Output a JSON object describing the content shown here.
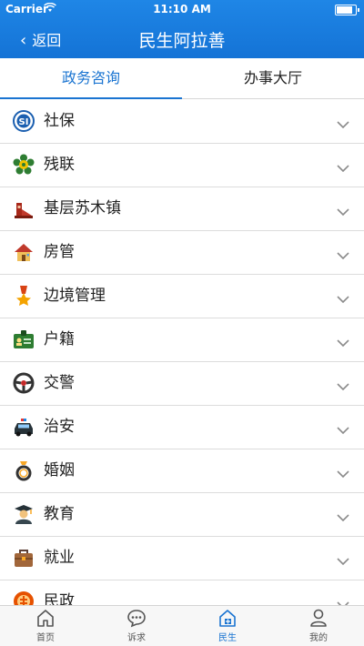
{
  "status": {
    "carrier": "Carrier",
    "time": "11:10 AM"
  },
  "nav": {
    "back_label": "返回",
    "title": "民生阿拉善"
  },
  "tabs": [
    {
      "label": "政务咨询",
      "active": true
    },
    {
      "label": "办事大厅",
      "active": false
    }
  ],
  "items": [
    {
      "label": "社保",
      "icon": "social-security-icon"
    },
    {
      "label": "残联",
      "icon": "disabled-federation-icon"
    },
    {
      "label": "基层苏木镇",
      "icon": "township-icon"
    },
    {
      "label": "房管",
      "icon": "house-icon"
    },
    {
      "label": "边境管理",
      "icon": "border-medal-icon"
    },
    {
      "label": "户籍",
      "icon": "id-card-icon"
    },
    {
      "label": "交警",
      "icon": "steering-wheel-icon"
    },
    {
      "label": "治安",
      "icon": "police-car-icon"
    },
    {
      "label": "婚姻",
      "icon": "ring-icon"
    },
    {
      "label": "教育",
      "icon": "graduate-icon"
    },
    {
      "label": "就业",
      "icon": "briefcase-icon"
    },
    {
      "label": "民政",
      "icon": "civil-affairs-icon"
    }
  ],
  "tabbar": [
    {
      "label": "首页",
      "icon": "home-icon",
      "active": false
    },
    {
      "label": "诉求",
      "icon": "chat-icon",
      "active": false
    },
    {
      "label": "民生",
      "icon": "livelihood-icon",
      "active": true
    },
    {
      "label": "我的",
      "icon": "profile-icon",
      "active": false
    }
  ],
  "colors": {
    "accent": "#1a74d1",
    "header": "#1a7de0"
  }
}
